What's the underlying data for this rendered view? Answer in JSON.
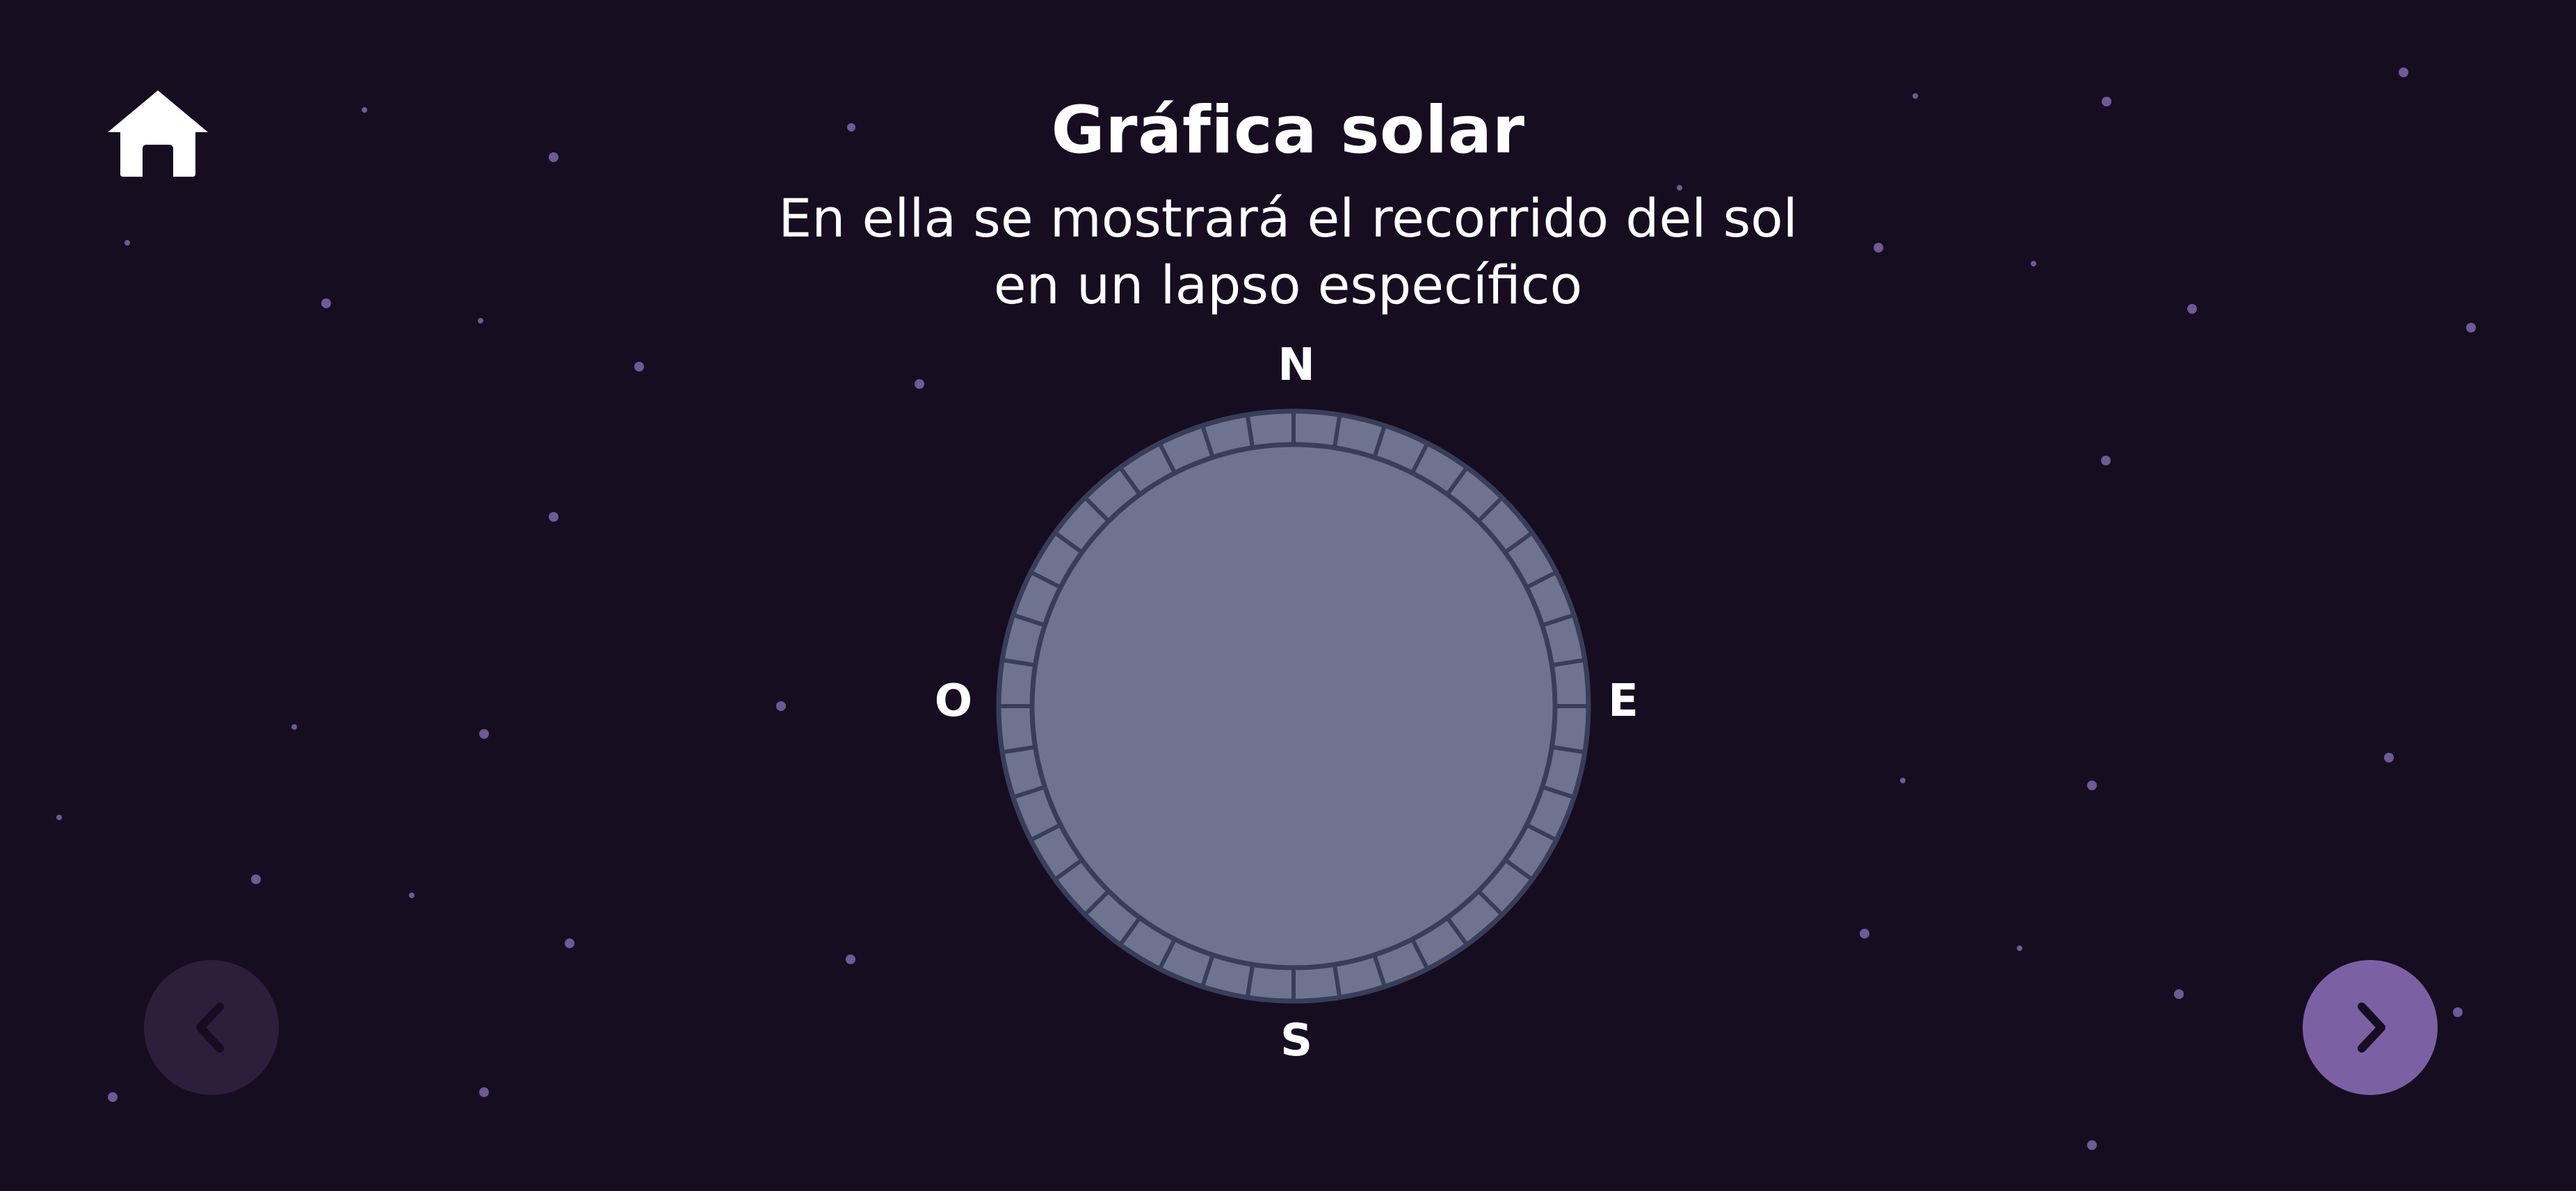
{
  "header": {
    "title": "Gráfica solar",
    "subtitle_line1": "En ella se mostrará el recorrido del sol",
    "subtitle_line2": "en un lapso específico"
  },
  "compass": {
    "north": "N",
    "south": "S",
    "east": "E",
    "west": "O"
  },
  "icons": {
    "home": "home-icon",
    "prev": "chevron-left-icon",
    "next": "chevron-right-icon"
  },
  "colors": {
    "background": "#160d21",
    "star": "#6e5a96",
    "dial_fill": "#6e738f",
    "dial_stroke": "#383d5a",
    "next_button": "#7b61a3",
    "prev_button": "#2b1f3c"
  }
}
